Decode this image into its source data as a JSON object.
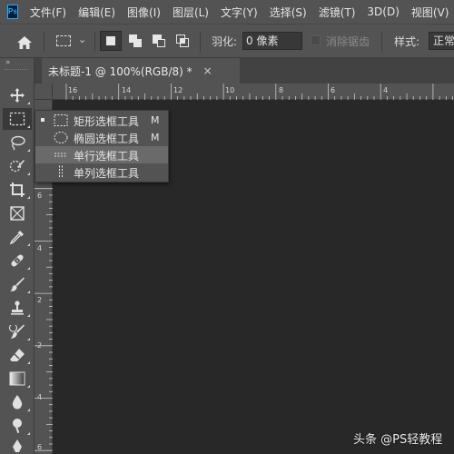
{
  "app": {
    "logo": "Ps"
  },
  "menu": [
    "文件(F)",
    "编辑(E)",
    "图像(I)",
    "图层(L)",
    "文字(Y)",
    "选择(S)",
    "滤镜(T)",
    "3D(D)",
    "视图(V)"
  ],
  "options": {
    "feather_label": "羽化:",
    "feather_value": "0 像素",
    "antialias_label": "消除锯齿",
    "style_label": "样式:",
    "style_value": "正常"
  },
  "document_tab": {
    "title": "未标题-1 @ 100%(RGB/8) *",
    "close": "×"
  },
  "ruler_top": [
    "16",
    "14",
    "12",
    "10",
    "8",
    "6",
    "4"
  ],
  "ruler_left": [
    "8",
    "6",
    "4",
    "2",
    "0",
    "2",
    "4",
    "6"
  ],
  "toolbar": {
    "collapse": "»",
    "tools": [
      "move-icon",
      "rectangular-marquee-icon",
      "lasso-icon",
      "quick-selection-icon",
      "crop-icon",
      "frame-icon",
      "eyedropper-icon",
      "healing-brush-icon",
      "brush-icon",
      "clone-stamp-icon",
      "history-brush-icon",
      "eraser-icon",
      "gradient-icon",
      "blur-icon",
      "dodge-icon",
      "pen-icon"
    ]
  },
  "flyout": {
    "items": [
      {
        "label": "矩形选框工具",
        "shortcut": "M",
        "icon": "rectangular-marquee-icon",
        "selected": true
      },
      {
        "label": "椭圆选框工具",
        "shortcut": "M",
        "icon": "elliptical-marquee-icon",
        "selected": false
      },
      {
        "label": "单行选框工具",
        "shortcut": "",
        "icon": "single-row-marquee-icon",
        "selected": false
      },
      {
        "label": "单列选框工具",
        "shortcut": "",
        "icon": "single-column-marquee-icon",
        "selected": false
      }
    ]
  },
  "watermark": "头条 @PS轻教程"
}
